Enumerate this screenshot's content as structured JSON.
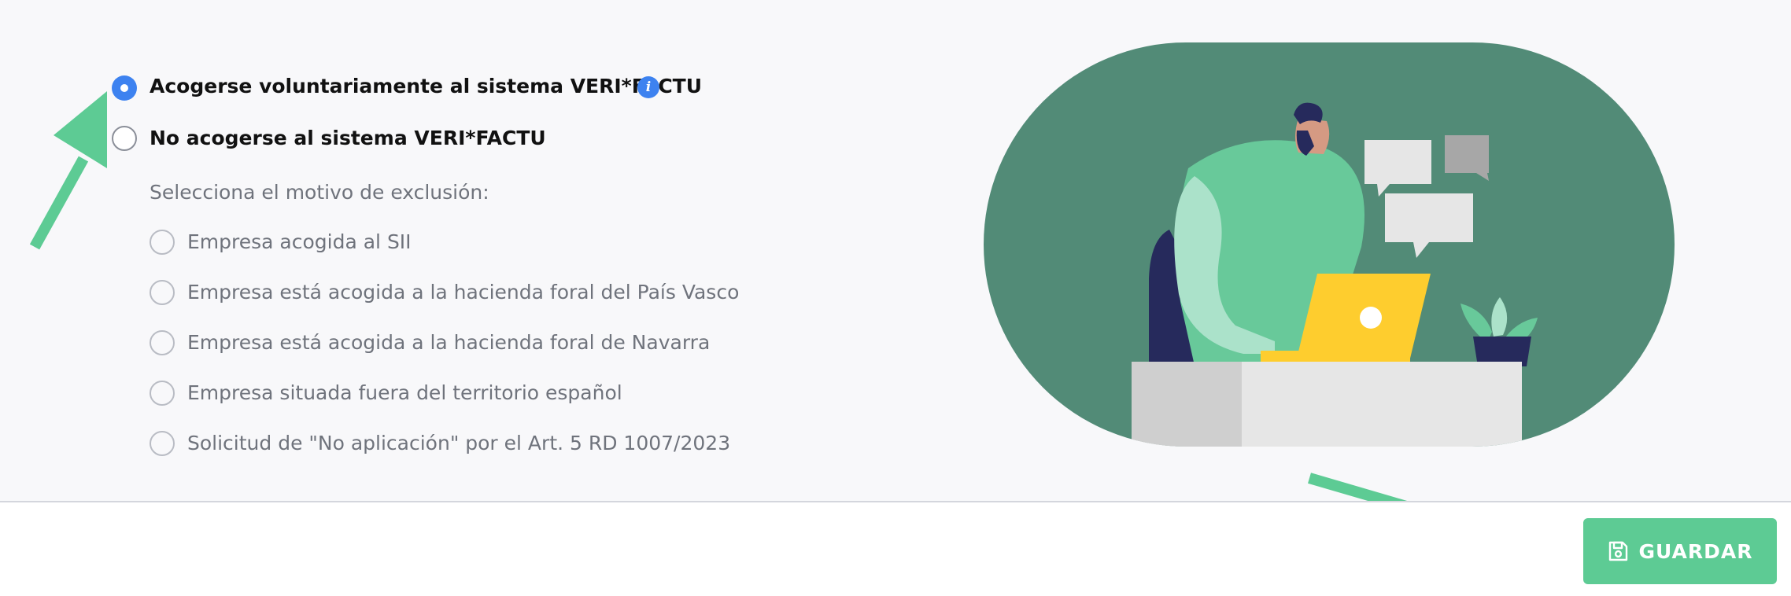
{
  "options": {
    "voluntary": {
      "label": "Acogerse voluntariamente al sistema VERI*FACTU",
      "selected": true
    },
    "not_voluntary": {
      "label": "No acogerse al sistema VERI*FACTU",
      "selected": false
    }
  },
  "exclusion": {
    "prompt": "Selecciona el motivo de exclusión:",
    "reasons": [
      "Empresa acogida al SII",
      "Empresa está acogida a la hacienda foral del País Vasco",
      "Empresa está acogida a la hacienda foral de Navarra",
      "Empresa situada fuera del territorio español",
      "Solicitud de \"No aplicación\" por el Art. 5 RD 1007/2023"
    ]
  },
  "info_icon_glyph": "i",
  "save_button": {
    "label": "GUARDAR",
    "icon": "save-icon"
  },
  "colors": {
    "accent_blue": "#3d82f0",
    "green_button": "#5dcb94",
    "arrow_green": "#5dcb94",
    "illustration_bg": "#528b77"
  }
}
